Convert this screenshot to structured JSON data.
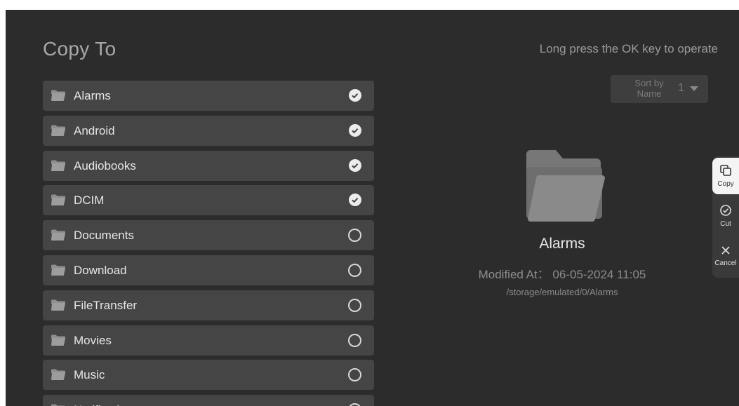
{
  "header": {
    "title": "Copy To",
    "hint": "Long press the OK key to operate"
  },
  "sort": {
    "label": "Sort by Name",
    "value": "1"
  },
  "folders": [
    {
      "name": "Alarms",
      "selected": true
    },
    {
      "name": "Android",
      "selected": true
    },
    {
      "name": "Audiobooks",
      "selected": true
    },
    {
      "name": "DCIM",
      "selected": true
    },
    {
      "name": "Documents",
      "selected": false
    },
    {
      "name": "Download",
      "selected": false
    },
    {
      "name": "FileTransfer",
      "selected": false
    },
    {
      "name": "Movies",
      "selected": false
    },
    {
      "name": "Music",
      "selected": false
    },
    {
      "name": "Notifications",
      "selected": false
    }
  ],
  "detail": {
    "name": "Alarms",
    "modified": "Modified At： 06-05-2024 11:05",
    "path": "/storage/emulated/0/Alarms"
  },
  "actions": {
    "copy": "Copy",
    "cut": "Cut",
    "cancel": "Cancel"
  },
  "icons": {
    "folder": "folder-icon",
    "check": "check-circle-icon",
    "unchecked": "empty-circle-icon",
    "copy": "copy-icon",
    "cut": "cut-icon",
    "cancel": "close-icon",
    "dropdown": "chevron-down-icon"
  },
  "colors": {
    "background": "#2c2c2c",
    "row": "#454545",
    "text": "#e6e6e6",
    "muted": "#8c8c8c"
  }
}
